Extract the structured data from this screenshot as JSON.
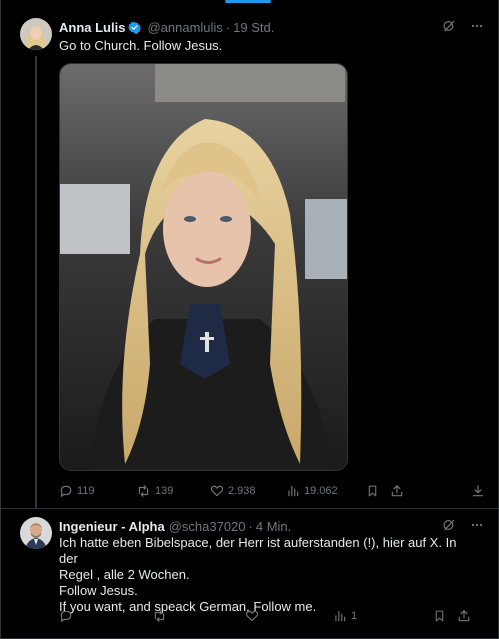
{
  "post": {
    "author_name": "Anna Lulis",
    "handle": "@annamlulis",
    "separator": "·",
    "time": "19 Std.",
    "text": "Go to Church. Follow Jesus.",
    "stats": {
      "replies": "119",
      "reposts": "139",
      "likes": "2.938",
      "views": "19.062"
    }
  },
  "reply": {
    "author_name": "Ingenieur - Alpha",
    "handle": "@scha37020",
    "separator": "·",
    "time": "4 Min.",
    "text_lines": [
      "Ich hatte eben Bibelspace, der Herr ist auferstanden (!), hier auf X. In der",
      "Regel , alle 2 Wochen.",
      "Follow Jesus.",
      "If you want, and speack German, Follow me."
    ],
    "stats": {
      "views": "1"
    }
  },
  "colors": {
    "accent": "#1d9bf0",
    "background": "#000000",
    "text": "#e7e9ea",
    "muted": "#71767b",
    "border": "#2f3336"
  }
}
